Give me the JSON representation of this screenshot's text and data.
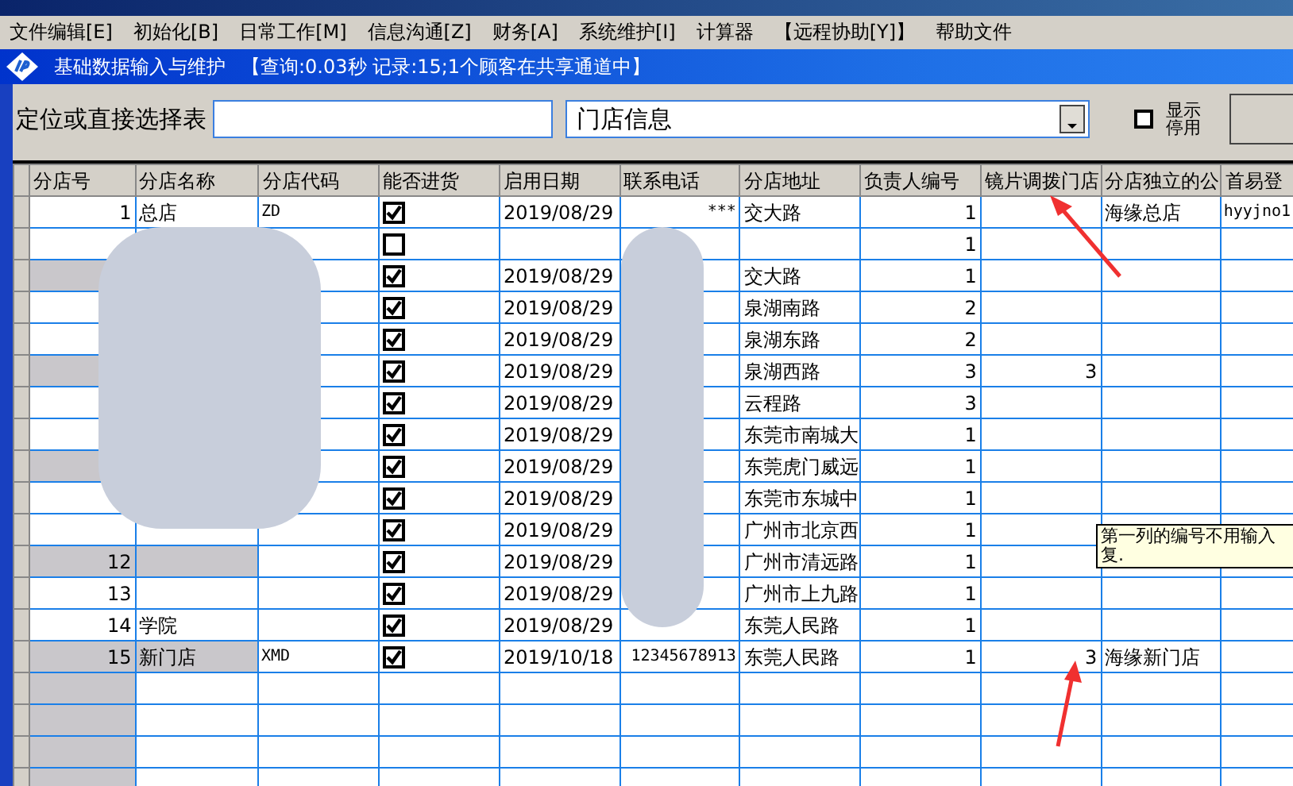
{
  "menu": [
    "文件编辑[E]",
    "初始化[B]",
    "日常工作[M]",
    "信息沟通[Z]",
    "财务[A]",
    "系统维护[I]",
    "计算器",
    "【远程协助[Y]】",
    "帮助文件"
  ],
  "subwindow": {
    "title": "基础数据输入与维护",
    "status": "【查询:0.03秒 记录:15;1个顾客在共享通道中】"
  },
  "toolbar": {
    "label": "定位或直接选择表",
    "table_select": "门店信息",
    "show_disabled": {
      "label_lines": [
        "显示",
        "停用"
      ],
      "checked": false
    }
  },
  "table": {
    "columns": [
      "分店号",
      "分店名称",
      "分店代码",
      "能否进货",
      "启用日期",
      "联系电话",
      "分店地址",
      "负责人编号",
      "镜片调拨门店",
      "分店独立的公",
      "首易登"
    ],
    "rows": [
      {
        "shaded": false,
        "cells": [
          "1",
          "总店",
          "ZD",
          true,
          "2019/08/29",
          "***",
          "交大路",
          "1",
          "",
          "海缘总店",
          "hyyjno1"
        ]
      },
      {
        "shaded": false,
        "cells": [
          "",
          "",
          "",
          false,
          "",
          "",
          "",
          "1",
          "",
          "",
          ""
        ]
      },
      {
        "shaded": true,
        "cells": [
          "",
          "",
          "",
          true,
          "2019/08/29",
          "",
          "交大路",
          "1",
          "",
          "",
          ""
        ]
      },
      {
        "shaded": false,
        "cells": [
          "",
          "",
          "",
          true,
          "2019/08/29",
          "",
          "泉湖南路",
          "2",
          "",
          "",
          ""
        ]
      },
      {
        "shaded": false,
        "cells": [
          "",
          "",
          "",
          true,
          "2019/08/29",
          "",
          "泉湖东路",
          "2",
          "",
          "",
          ""
        ]
      },
      {
        "shaded": true,
        "cells": [
          "",
          "",
          "",
          true,
          "2019/08/29",
          "",
          "泉湖西路",
          "3",
          "3",
          "",
          ""
        ]
      },
      {
        "shaded": false,
        "cells": [
          "",
          "",
          "",
          true,
          "2019/08/29",
          "",
          "云程路",
          "3",
          "",
          "",
          ""
        ]
      },
      {
        "shaded": false,
        "cells": [
          "",
          "",
          "",
          true,
          "2019/08/29",
          "",
          "东莞市南城大",
          "1",
          "",
          "",
          ""
        ]
      },
      {
        "shaded": true,
        "cells": [
          "",
          "",
          "",
          true,
          "2019/08/29",
          "",
          "东莞虎门威远",
          "1",
          "",
          "",
          ""
        ]
      },
      {
        "shaded": false,
        "cells": [
          "",
          "",
          "",
          true,
          "2019/08/29",
          "",
          "东莞市东城中",
          "1",
          "",
          "",
          ""
        ]
      },
      {
        "shaded": false,
        "cells": [
          "",
          "",
          "",
          true,
          "2019/08/29",
          "",
          "广州市北京西",
          "1",
          "",
          "",
          ""
        ]
      },
      {
        "shaded": true,
        "cells": [
          "12",
          "",
          "",
          true,
          "2019/08/29",
          "",
          "广州市清远路",
          "1",
          "",
          "",
          ""
        ]
      },
      {
        "shaded": false,
        "cells": [
          "13",
          "",
          "",
          true,
          "2019/08/29",
          "",
          "广州市上九路",
          "1",
          "",
          "",
          ""
        ]
      },
      {
        "shaded": false,
        "cells": [
          "14",
          "学院",
          "",
          true,
          "2019/08/29",
          "",
          "东莞人民路",
          "1",
          "",
          "",
          ""
        ]
      },
      {
        "shaded": true,
        "cells": [
          "15",
          "新门店",
          "XMD",
          true,
          "2019/10/18",
          "12345678913",
          "东莞人民路",
          "1",
          "3",
          "海缘新门店",
          ""
        ]
      }
    ]
  },
  "tooltip": {
    "lines": [
      "第一列的编号不用输入",
      "复."
    ]
  }
}
